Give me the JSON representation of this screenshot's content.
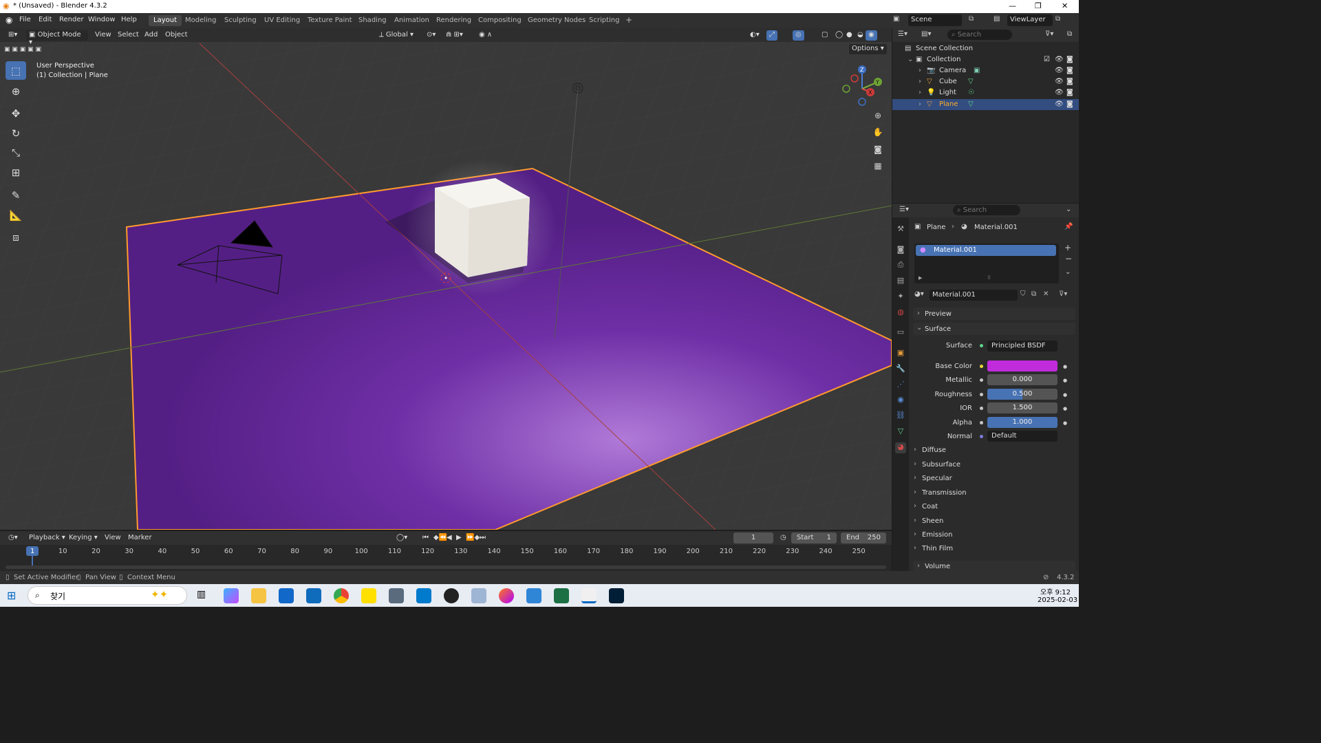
{
  "window": {
    "title": "* (Unsaved) - Blender 4.3.2",
    "minimize": "—",
    "restore": "❐",
    "close": "✕"
  },
  "menus": [
    "File",
    "Edit",
    "Render",
    "Window",
    "Help"
  ],
  "workspaces": [
    "Layout",
    "Modeling",
    "Sculpting",
    "UV Editing",
    "Texture Paint",
    "Shading",
    "Animation",
    "Rendering",
    "Compositing",
    "Geometry Nodes",
    "Scripting"
  ],
  "workspace_add": "+",
  "scene": {
    "label": "Scene",
    "viewlayer": "ViewLayer"
  },
  "viewport": {
    "mode": "Object Mode",
    "menus": [
      "View",
      "Select",
      "Add",
      "Object"
    ],
    "transform": "Global",
    "options": "Options",
    "overlay_title": "User Perspective",
    "overlay_sub": "(1) Collection | Plane"
  },
  "gizmo": {
    "z": "Z",
    "y": "Y",
    "x": "X"
  },
  "outliner": {
    "search_placeholder": "Search",
    "scene_collection": "Scene Collection",
    "collection": "Collection",
    "items": [
      {
        "name": "Camera"
      },
      {
        "name": "Cube"
      },
      {
        "name": "Light"
      },
      {
        "name": "Plane"
      }
    ]
  },
  "properties": {
    "search_placeholder": "Search",
    "breadcrumb_object": "Plane",
    "breadcrumb_material": "Material.001",
    "slot": "Material.001",
    "material_name": "Material.001",
    "panel_preview": "Preview",
    "panel_surface": "Surface",
    "surface_label": "Surface",
    "surface_value": "Principled BSDF",
    "fields": [
      {
        "label": "Base Color",
        "value": "",
        "color": "#c02bdc"
      },
      {
        "label": "Metallic",
        "value": "0.000",
        "fill": 0
      },
      {
        "label": "Roughness",
        "value": "0.500",
        "fill": 0.5
      },
      {
        "label": "IOR",
        "value": "1.500",
        "fill": 0
      },
      {
        "label": "Alpha",
        "value": "1.000",
        "fill": 1
      }
    ],
    "normal_label": "Normal",
    "normal_value": "Default",
    "subpanels": [
      "Diffuse",
      "Subsurface",
      "Specular",
      "Transmission",
      "Coat",
      "Sheen",
      "Emission",
      "Thin Film"
    ],
    "panel_volume": "Volume"
  },
  "timeline": {
    "menus": [
      "Playback",
      "Keying",
      "View",
      "Marker"
    ],
    "current_frame": "1",
    "start_label": "Start",
    "start": "1",
    "end_label": "End",
    "end": "250",
    "ticks": [
      "1",
      "10",
      "20",
      "30",
      "40",
      "50",
      "60",
      "70",
      "80",
      "90",
      "100",
      "110",
      "120",
      "130",
      "140",
      "150",
      "160",
      "170",
      "180",
      "190",
      "200",
      "210",
      "220",
      "230",
      "240",
      "250"
    ]
  },
  "status": {
    "items": [
      "Set Active Modifier",
      "Pan View",
      "Context Menu"
    ],
    "version": "4.3.2"
  },
  "taskbar": {
    "search": "찾기",
    "time": "오후 9:12",
    "date": "2025-02-03"
  }
}
